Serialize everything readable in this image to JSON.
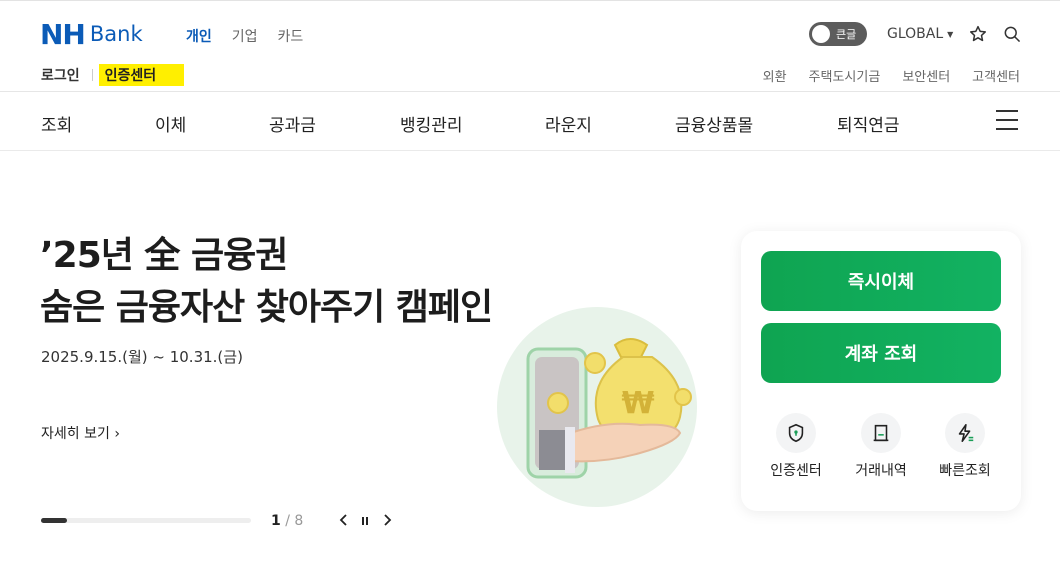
{
  "header": {
    "logo_nh": "NH",
    "logo_bank": "Bank",
    "segments": [
      "개인",
      "기업",
      "카드"
    ],
    "active_segment": "개인",
    "font_toggle_label": "큰글",
    "global_label": "GLOBAL",
    "login_label": "로그인",
    "cert_label": "인증센터",
    "util_links": [
      "외환",
      "주택도시기금",
      "보안센터",
      "고객센터"
    ]
  },
  "nav": {
    "items": [
      "조회",
      "이체",
      "공과금",
      "뱅킹관리",
      "라운지",
      "금융상품몰",
      "퇴직연금"
    ]
  },
  "hero": {
    "title_line1": "’25년 全 금융권",
    "title_line2": "숨은 금융자산 찾아주기 캠페인",
    "date": "2025.9.15.(월) ~ 10.31.(금)",
    "more_label": "자세히 보기",
    "current_slide": "1",
    "total_slides": "/ 8",
    "progress_fraction": 0.125
  },
  "quick_panel": {
    "instant_transfer": "즉시이체",
    "account_inquiry": "계좌 조회",
    "links": [
      "인증센터",
      "거래내역",
      "빠른조회"
    ]
  },
  "colors": {
    "brand_blue": "#0b5bb7",
    "green": "#0fa451",
    "highlight": "#ffef00"
  }
}
